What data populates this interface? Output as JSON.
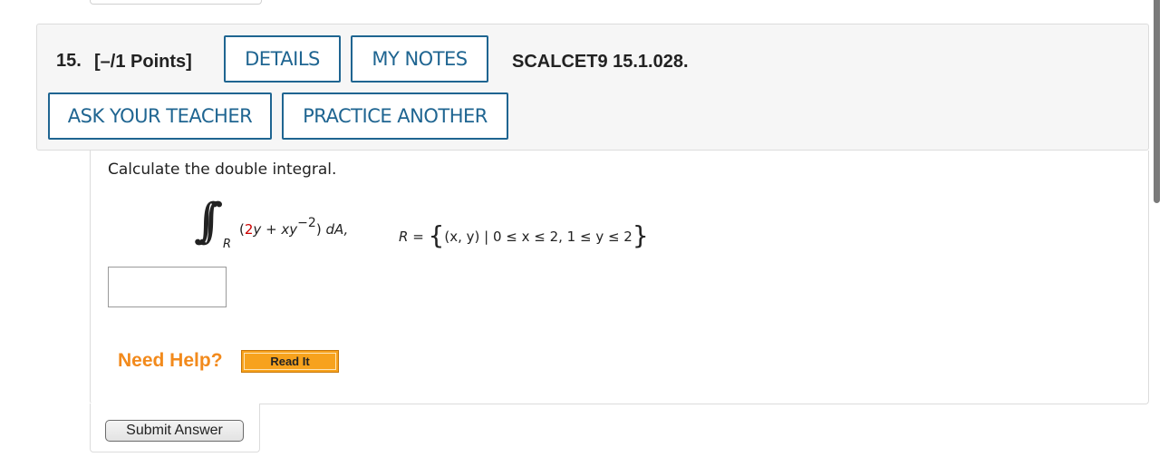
{
  "question": {
    "number": "15.",
    "points": "[–/1 Points]",
    "reference": "SCALCET9 15.1.028."
  },
  "buttons": {
    "details": "DETAILS",
    "my_notes": "MY NOTES",
    "ask_teacher": "ASK YOUR TEACHER",
    "practice_another": "PRACTICE ANOTHER",
    "read_it": "Read It",
    "submit": "Submit Answer"
  },
  "problem": {
    "prompt": "Calculate the double integral.",
    "integral_symbol": "∫∫",
    "region_sub": "R",
    "integrand_open": "(",
    "coef": "2",
    "y_var": "y",
    "plus": " + ",
    "xy": "xy",
    "exponent": "−2",
    "close": ")",
    "da": " dA,",
    "region_label": "R",
    "equals": " = ",
    "set_open": "{",
    "set_body": "(x, y) | 0 ≤ x ≤ 2, 1 ≤ y ≤ 2",
    "set_close": "}"
  },
  "answer": {
    "value": ""
  },
  "help": {
    "label": "Need Help?"
  },
  "colors": {
    "button_blue": "#1f6591",
    "help_orange": "#f28a1c",
    "read_it_orange": "#f7a21d",
    "highlight_red": "#cc0000"
  }
}
